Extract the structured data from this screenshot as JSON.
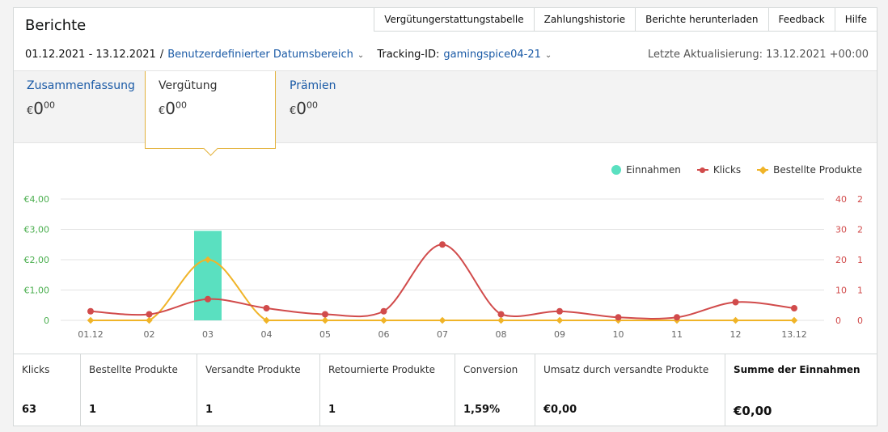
{
  "header": {
    "title": "Berichte",
    "nav": [
      "Vergütungerstattungstabelle",
      "Zahlungshistorie",
      "Berichte herunterladen",
      "Feedback",
      "Hilfe"
    ]
  },
  "filters": {
    "date_range": "01.12.2021 - 13.12.2021",
    "separator": "/",
    "range_type": "Benutzerdefinierter Datumsbereich",
    "tracking_label": "Tracking-ID:",
    "tracking_id": "gamingspice04-21",
    "last_update": "Letzte Aktualisierung: 13.12.2021 +00:00"
  },
  "summary_tabs": [
    {
      "label": "Zusammenfassung",
      "currency": "€",
      "amount": "0",
      "cents": "00"
    },
    {
      "label": "Vergütung",
      "currency": "€",
      "amount": "0",
      "cents": "00"
    },
    {
      "label": "Prämien",
      "currency": "€",
      "amount": "0",
      "cents": "00"
    }
  ],
  "colors": {
    "earnings": "#5ae0c0",
    "clicks": "#d14b4b",
    "ordered": "#f0b428",
    "left_axis": "#4caf50",
    "right_axis": "#d14b4b"
  },
  "chart_data": {
    "type": "bar",
    "categories": [
      "01.12",
      "02",
      "03",
      "04",
      "05",
      "06",
      "07",
      "08",
      "09",
      "10",
      "11",
      "12",
      "13.12"
    ],
    "series": [
      {
        "name": "Einnahmen",
        "type": "bar",
        "axis": "left",
        "values": [
          0,
          0,
          2.95,
          0,
          0,
          0,
          0,
          0,
          0,
          0,
          0,
          0,
          0
        ]
      },
      {
        "name": "Klicks",
        "type": "line",
        "axis": "right_clicks",
        "values": [
          3,
          2,
          7,
          4,
          2,
          3,
          25,
          2,
          3,
          1,
          1,
          6,
          4
        ]
      },
      {
        "name": "Bestellte Produkte",
        "type": "line",
        "axis": "right_products",
        "values": [
          0,
          0,
          1,
          0,
          0,
          0,
          0,
          0,
          0,
          0,
          0,
          0,
          0
        ]
      }
    ],
    "left_axis": {
      "ticks": [
        "€4,00",
        "€3,00",
        "€2,00",
        "€1,00",
        "0"
      ],
      "ylim": [
        0,
        4
      ]
    },
    "right_axis_clicks": {
      "ticks": [
        "40",
        "30",
        "20",
        "10",
        "0"
      ],
      "ylim": [
        0,
        40
      ]
    },
    "right_axis_products": {
      "ticks": [
        "2",
        "2",
        "1",
        "1",
        "0"
      ],
      "ylim": [
        0,
        2
      ]
    },
    "legend_position": "top-right",
    "grid": true
  },
  "stats": [
    {
      "label": "Klicks",
      "value": "63"
    },
    {
      "label": "Bestellte Produkte",
      "value": "1"
    },
    {
      "label": "Versandte Produkte",
      "value": "1"
    },
    {
      "label": "Retournierte Produkte",
      "value": "1"
    },
    {
      "label": "Conversion",
      "value": "1,59%"
    },
    {
      "label": "Umsatz durch versandte Produkte",
      "value": "€0,00"
    },
    {
      "label": "Summe der Einnahmen",
      "value": "€0,00"
    }
  ]
}
